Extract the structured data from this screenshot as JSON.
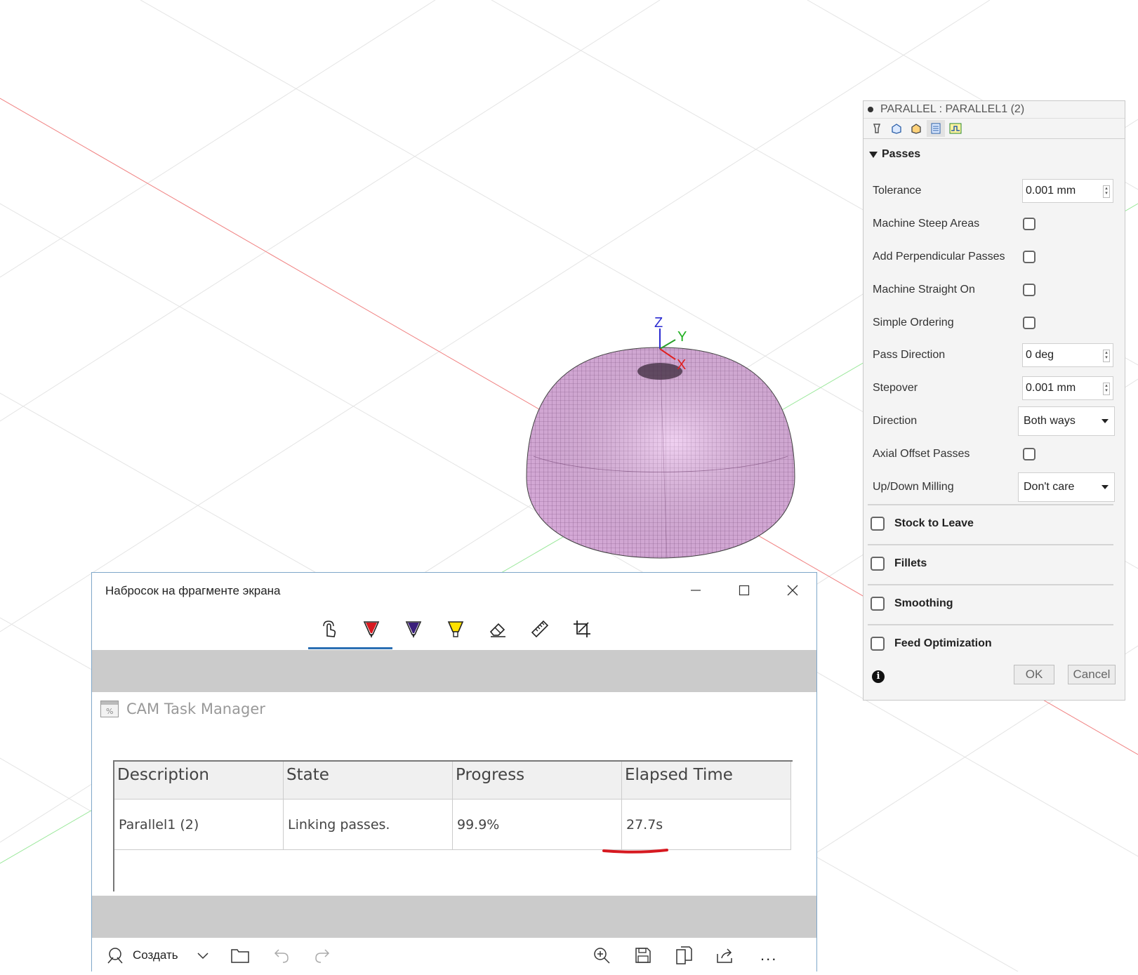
{
  "viewport": {
    "axis_labels": {
      "z": "Z",
      "y": "Y",
      "x": "X"
    },
    "model_color": "#e8b8ea",
    "mesh_color": "#6a3a6a"
  },
  "panel": {
    "title": "PARALLEL : PARALLEL1 (2)",
    "tab_icons": [
      "tool-icon",
      "geometry-icon",
      "heights-icon",
      "passes-icon",
      "linking-icon"
    ],
    "passes_section": "Passes",
    "params": {
      "tolerance": {
        "label": "Tolerance",
        "value": "0.001 mm"
      },
      "machine_steep_areas": {
        "label": "Machine Steep Areas"
      },
      "add_perpendicular_passes": {
        "label": "Add Perpendicular Passes"
      },
      "machine_straight_on": {
        "label": "Machine Straight On"
      },
      "simple_ordering": {
        "label": "Simple Ordering"
      },
      "pass_direction": {
        "label": "Pass Direction",
        "value": "0 deg"
      },
      "stepover": {
        "label": "Stepover",
        "value": "0.001 mm"
      },
      "direction": {
        "label": "Direction",
        "value": "Both ways"
      },
      "axial_offset_passes": {
        "label": "Axial Offset Passes"
      },
      "up_down_milling": {
        "label": "Up/Down Milling",
        "value": "Don't care"
      }
    },
    "groups": [
      "Stock to Leave",
      "Fillets",
      "Smoothing",
      "Feed Optimization"
    ],
    "info_glyph": "i",
    "ok_label": "OK",
    "cancel_label": "Cancel"
  },
  "snip": {
    "window_title": "Набросок на фрагменте экрана",
    "tools": [
      "touch-writing-icon",
      "ballpoint-pen-icon",
      "pencil-icon",
      "highlighter-icon",
      "eraser-icon",
      "ruler-icon",
      "crop-icon"
    ],
    "new_label": "Создать",
    "more_label": "...",
    "task_manager": {
      "title": "CAM Task Manager",
      "columns": [
        "Description",
        "State",
        "Progress",
        "Elapsed Time"
      ],
      "rows": [
        [
          "Parallel1 (2)",
          "Linking passes.",
          "99.9%",
          "27.7s"
        ]
      ]
    }
  }
}
